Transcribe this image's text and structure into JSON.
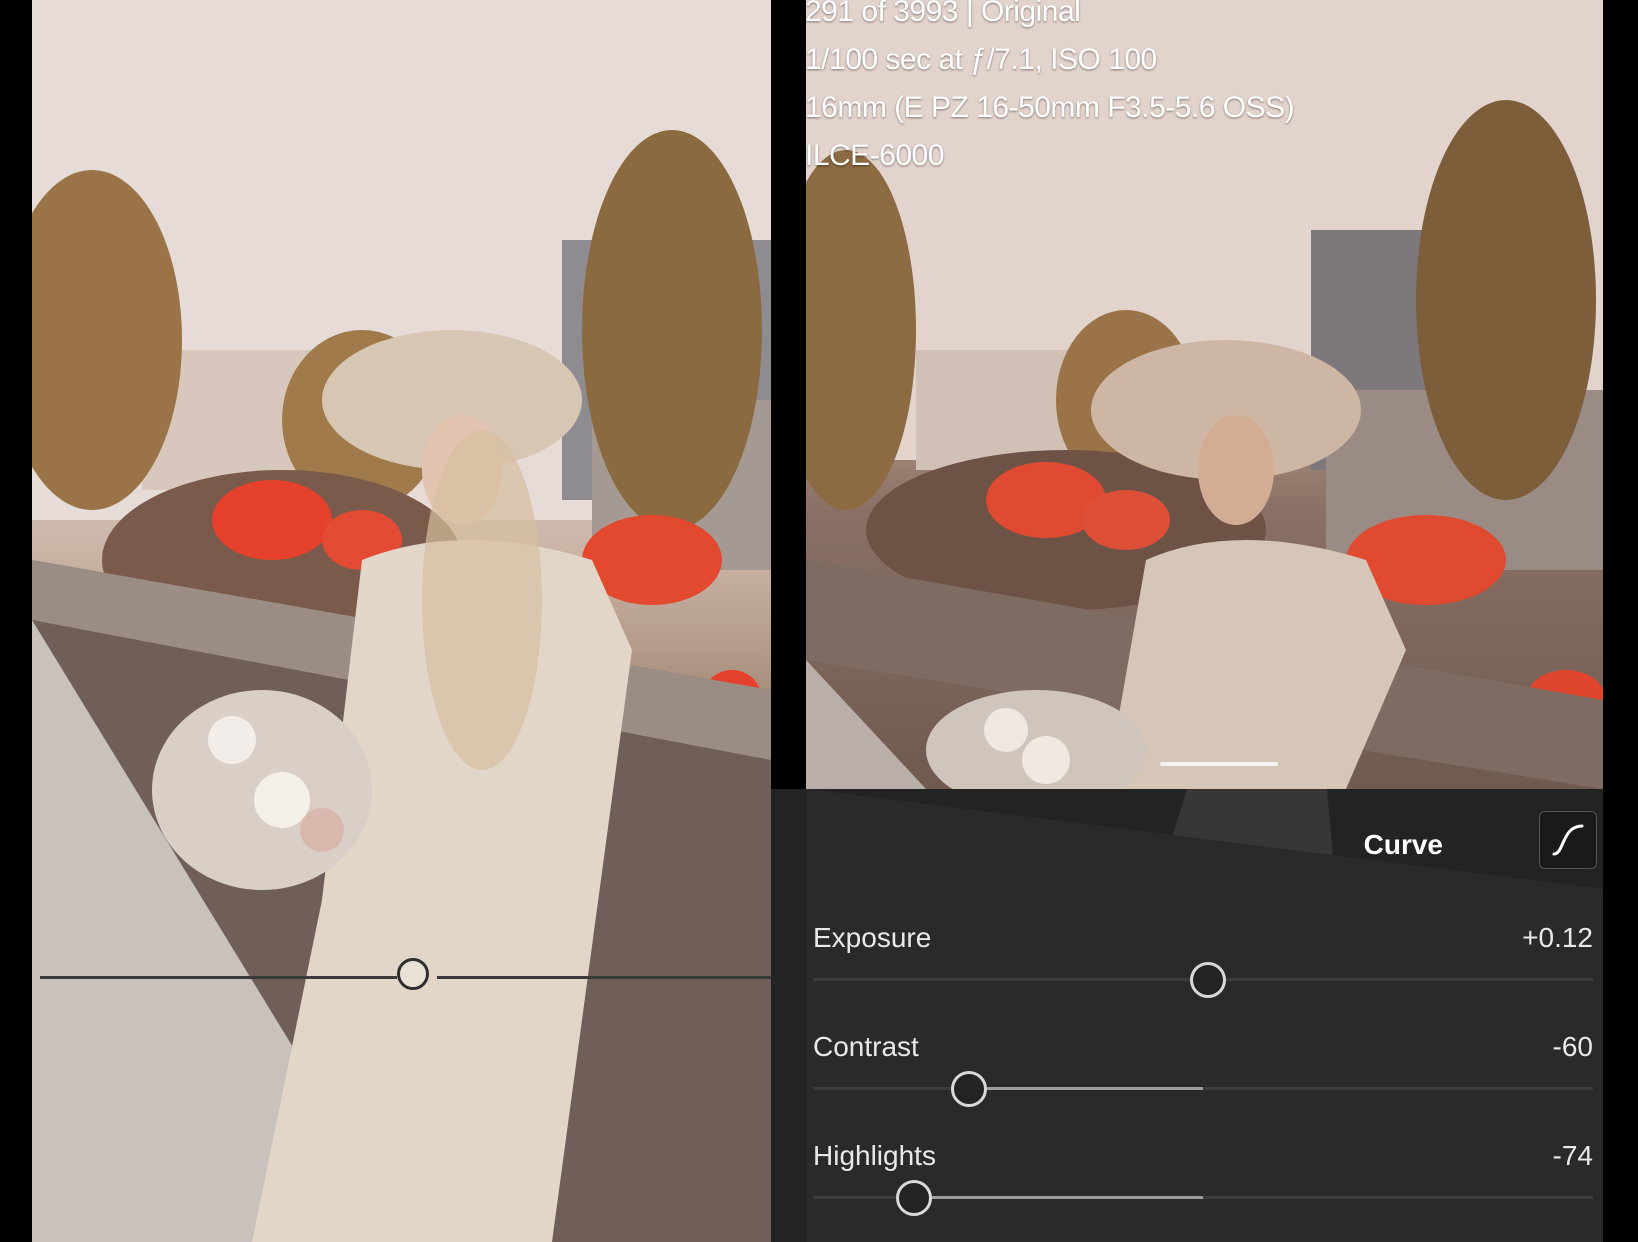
{
  "info": {
    "line1": "291 of 3993 | Original",
    "line2": "1/100 sec at ƒ/7.1, ISO 100",
    "line3": "16mm (E PZ 16-50mm F3.5-5.6 OSS)",
    "line4": "ILCE-6000"
  },
  "panel": {
    "curve_label": "Curve",
    "sliders": [
      {
        "label": "Exposure",
        "value": "+0.12",
        "level": 0.506
      },
      {
        "label": "Contrast",
        "value": "-60",
        "level": 0.2
      },
      {
        "label": "Highlights",
        "value": "-74",
        "level": 0.13
      }
    ]
  },
  "compare_split": {
    "level": 0.516
  },
  "colors": {
    "panel_bg": "#232323",
    "slider_track": "#3b3b3b",
    "slider_fill": "#9d9d9d",
    "accent_flowers": "#e6412c"
  }
}
